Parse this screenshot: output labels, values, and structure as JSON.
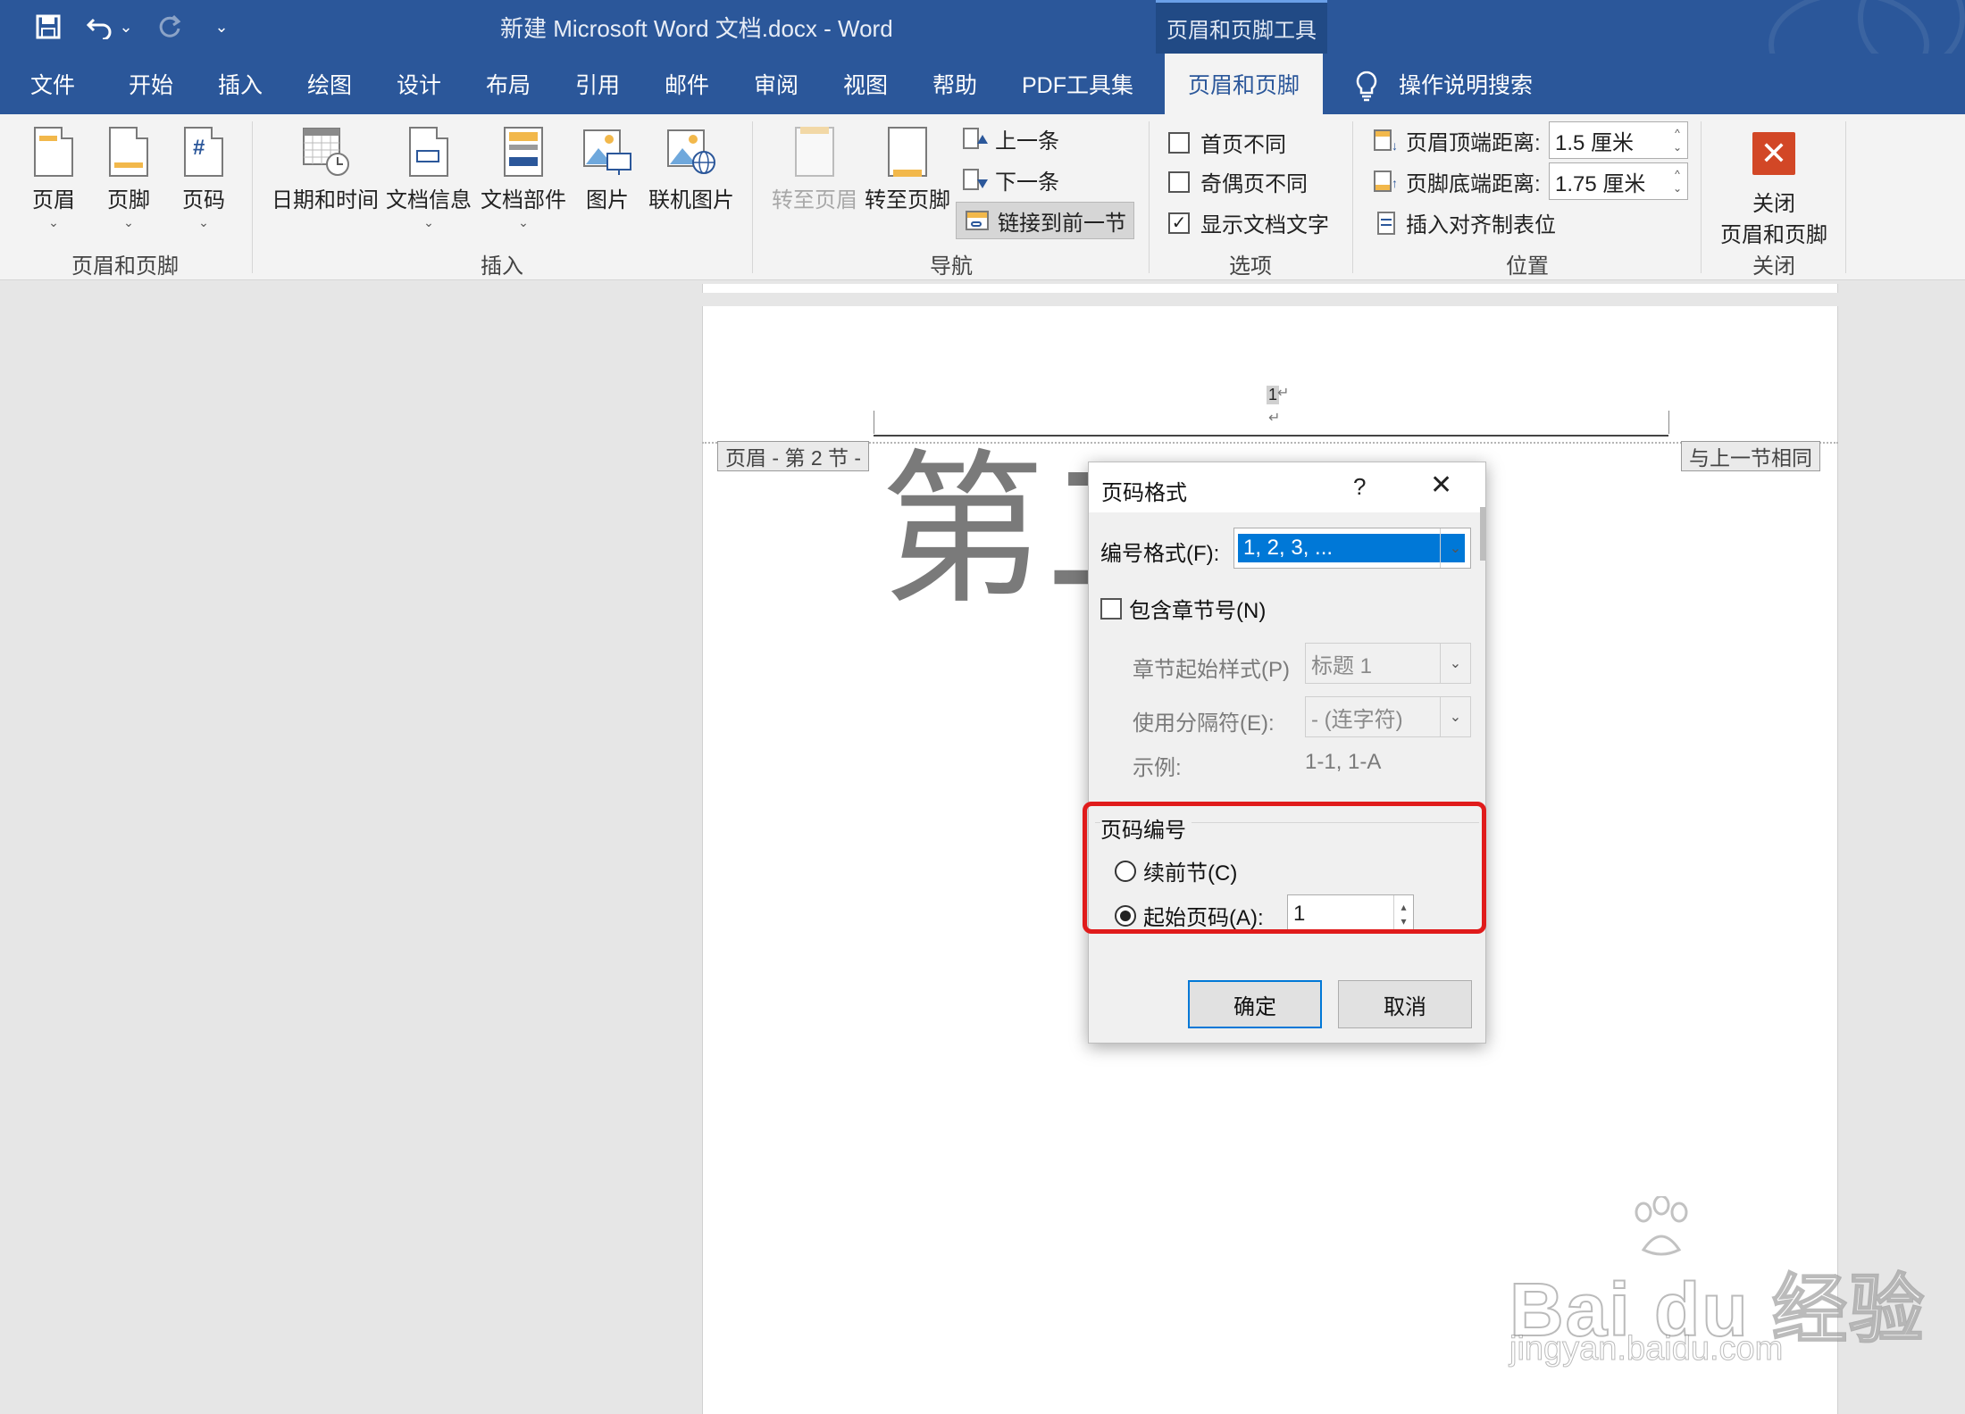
{
  "titlebar": {
    "title": "新建 Microsoft Word 文档.docx  -  Word",
    "context_tab_group": "页眉和页脚工具",
    "undo_caret": "⌄",
    "customize_caret": "⌄"
  },
  "tabs": [
    "文件",
    "开始",
    "插入",
    "绘图",
    "设计",
    "布局",
    "引用",
    "邮件",
    "审阅",
    "视图",
    "帮助",
    "PDF工具集",
    "页眉和页脚"
  ],
  "active_tab": "页眉和页脚",
  "tell_me": "操作说明搜索",
  "ribbon": {
    "header_footer_group": {
      "label": "页眉和页脚",
      "buttons": [
        "页眉",
        "页脚",
        "页码"
      ]
    },
    "insert_group": {
      "label": "插入",
      "buttons": [
        "日期和时间",
        "文档信息",
        "文档部件",
        "图片",
        "联机图片"
      ]
    },
    "navigation_group": {
      "label": "导航",
      "goto_header": "转至页眉",
      "goto_footer": "转至页脚",
      "previous": "上一条",
      "next": "下一条",
      "link_to_previous": "链接到前一节"
    },
    "options_group": {
      "label": "选项",
      "different_first_page": "首页不同",
      "different_odd_even": "奇偶页不同",
      "show_doc_text": "显示文档文字",
      "different_first_page_checked": false,
      "different_odd_even_checked": false,
      "show_doc_text_checked": true
    },
    "position_group": {
      "label": "位置",
      "header_from_top_label": "页眉顶端距离:",
      "header_from_top_value": "1.5 厘米",
      "footer_from_bottom_label": "页脚底端距离:",
      "footer_from_bottom_value": "1.75 厘米",
      "insert_alignment_tab": "插入对齐制表位"
    },
    "close_group": {
      "label": "关闭",
      "close_line1": "关闭",
      "close_line2": "页眉和页脚"
    }
  },
  "document": {
    "header_tag": "页眉 - 第 2 节 -",
    "same_as_previous_tag": "与上一节相同",
    "page_number_field": "1",
    "heading_visible": "第二"
  },
  "dialog": {
    "title": "页码格式",
    "help": "?",
    "close": "✕",
    "number_format_label": "编号格式(F):",
    "number_format_value": "1, 2, 3, ...",
    "include_chapter_label": "包含章节号(N)",
    "include_chapter_checked": false,
    "chapter_style_label": "章节起始样式(P)",
    "chapter_style_value": "标题 1",
    "separator_label": "使用分隔符(E):",
    "separator_value": "-   (连字符)",
    "example_label": "示例:",
    "example_value": "1-1, 1-A",
    "page_numbering_legend": "页码编号",
    "continue_label": "续前节(C)",
    "start_at_label": "起始页码(A):",
    "start_at_value": "1",
    "start_at_selected": true,
    "ok": "确定",
    "cancel": "取消"
  },
  "watermark": {
    "main": "Bai du 经验",
    "sub": "jingyan.baidu.com"
  },
  "colors": {
    "title_blue": "#2b579a",
    "highlight_red": "#e01b1b",
    "selection_blue": "#0078d7"
  }
}
